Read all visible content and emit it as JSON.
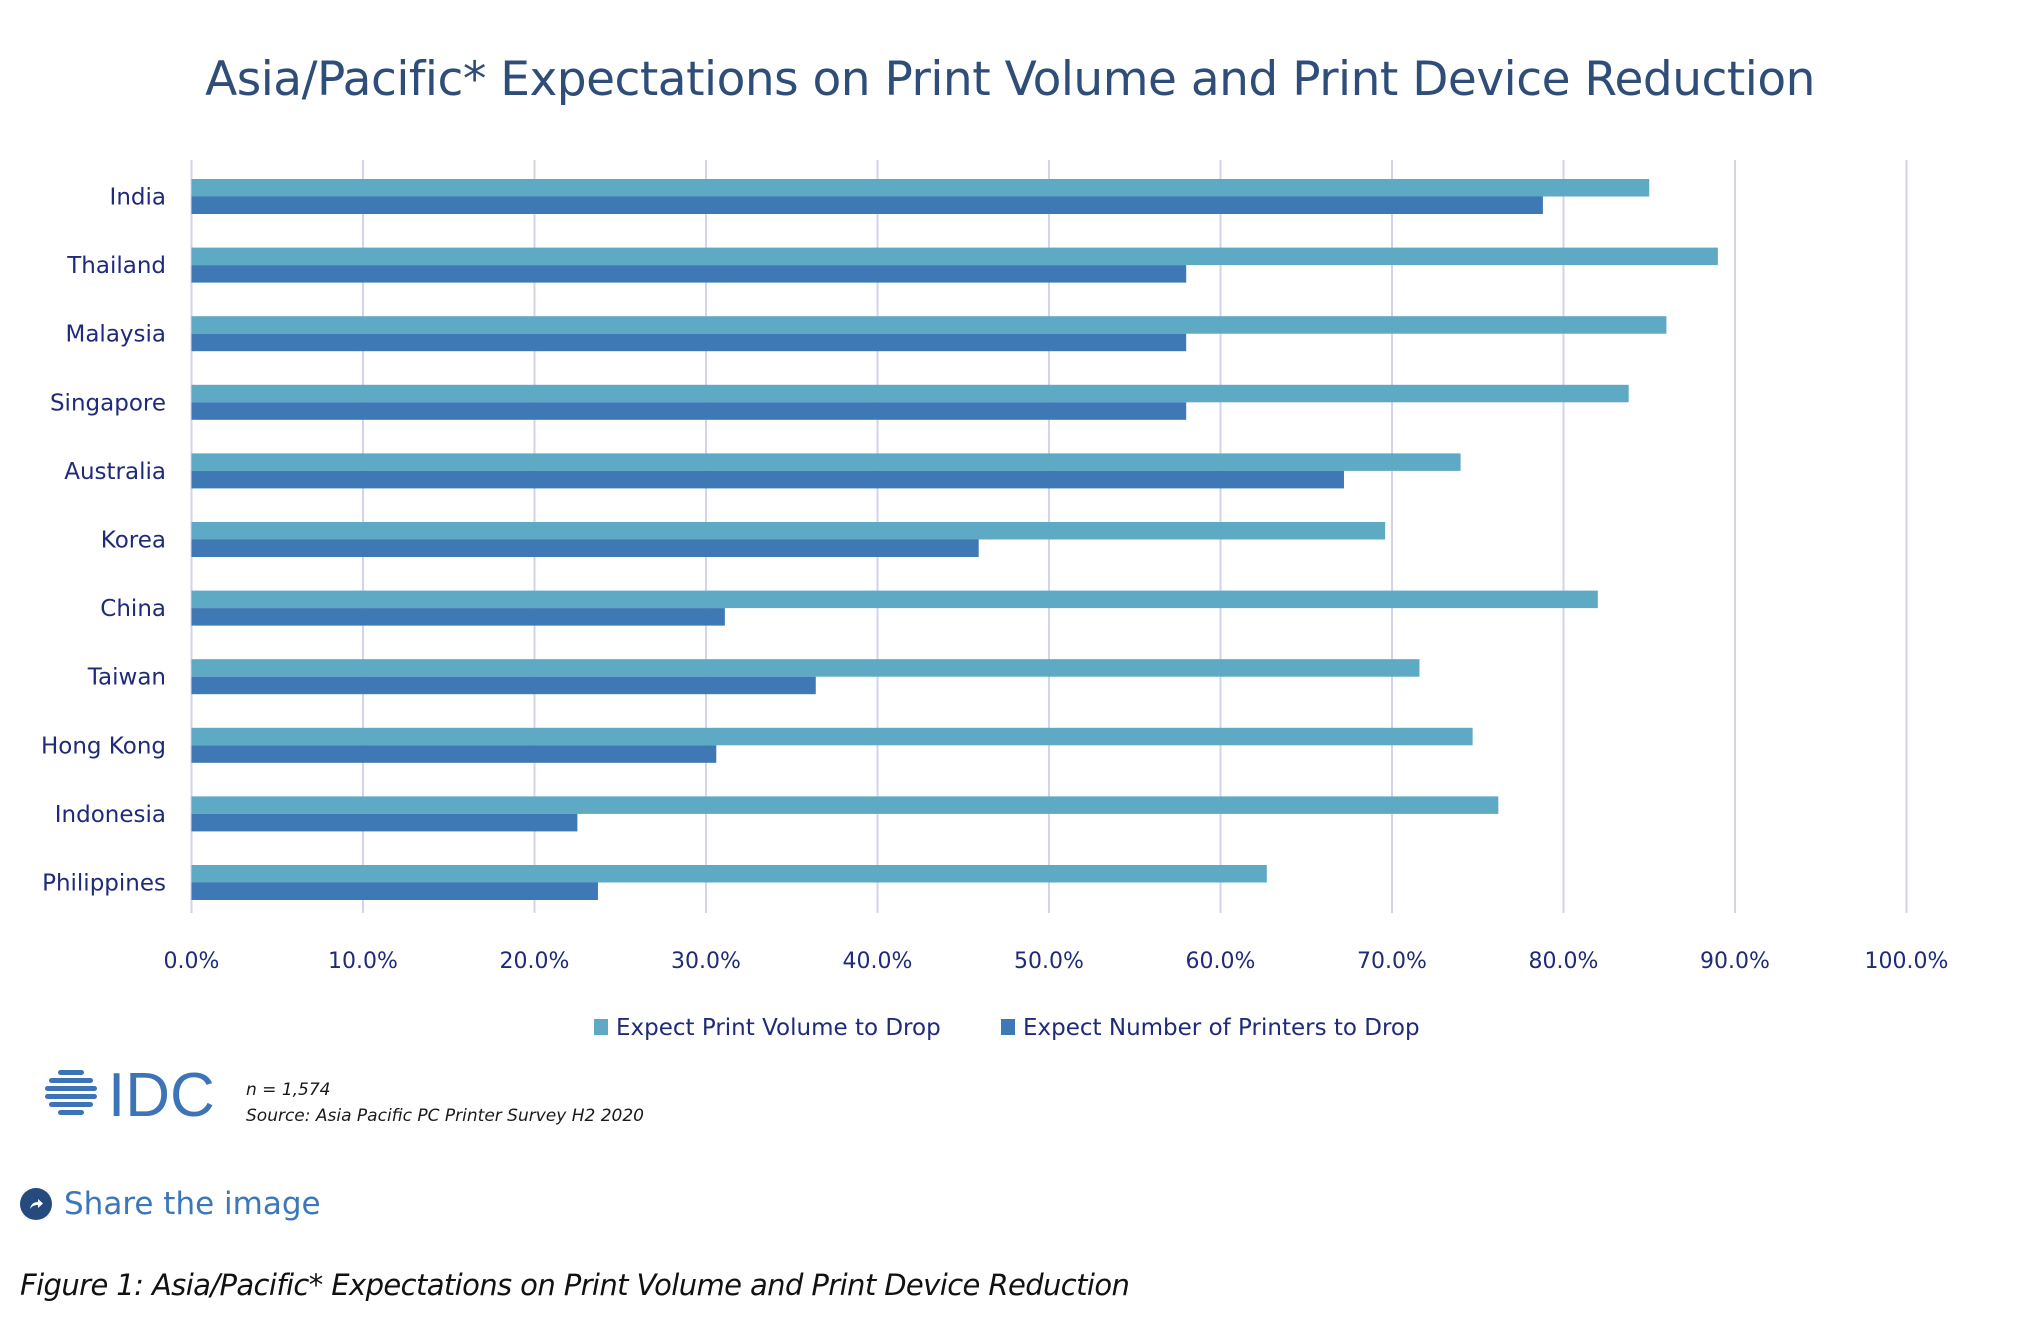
{
  "chart_data": {
    "type": "bar",
    "orientation": "horizontal",
    "title": "Asia/Pacific* Expectations on Print Volume and Print Device Reduction",
    "xlabel": "",
    "ylabel": "",
    "xlim": [
      0,
      100
    ],
    "x_ticks": [
      "0.0%",
      "10.0%",
      "20.0%",
      "30.0%",
      "40.0%",
      "50.0%",
      "60.0%",
      "70.0%",
      "80.0%",
      "90.0%",
      "100.0%"
    ],
    "grid": "vertical",
    "legend_position": "bottom",
    "categories": [
      "India",
      "Thailand",
      "Malaysia",
      "Singapore",
      "Australia",
      "Korea",
      "China",
      "Taiwan",
      "Hong Kong",
      "Indonesia",
      "Philippines"
    ],
    "series": [
      {
        "name": "Expect Print Volume to Drop",
        "color": "#5EA9C3",
        "values": [
          85.0,
          89.0,
          86.0,
          83.8,
          74.0,
          69.6,
          82.0,
          71.6,
          74.7,
          76.2,
          62.7
        ]
      },
      {
        "name": "Expect Number of Printers to Drop",
        "color": "#3E78B5",
        "values": [
          78.8,
          58.0,
          58.0,
          58.0,
          67.2,
          45.9,
          31.1,
          36.4,
          30.6,
          22.5,
          23.7
        ]
      }
    ]
  },
  "footer": {
    "logo_text": "IDC",
    "sample_size": "n = 1,574",
    "source": "Source: Asia Pacific PC Printer Survey H2 2020"
  },
  "share": {
    "label": "Share the image",
    "icon": "share-arrow-icon"
  },
  "caption": "Figure 1: Asia/Pacific* Expectations on Print Volume and Print Device Reduction",
  "colors": {
    "title": "#2E4D78",
    "axis_text": "#1F2A7A",
    "gridline": "#D3D3EA",
    "logo": "#3D74B8",
    "share_link": "#3C77B9",
    "share_icon_bg": "#244A7E"
  }
}
